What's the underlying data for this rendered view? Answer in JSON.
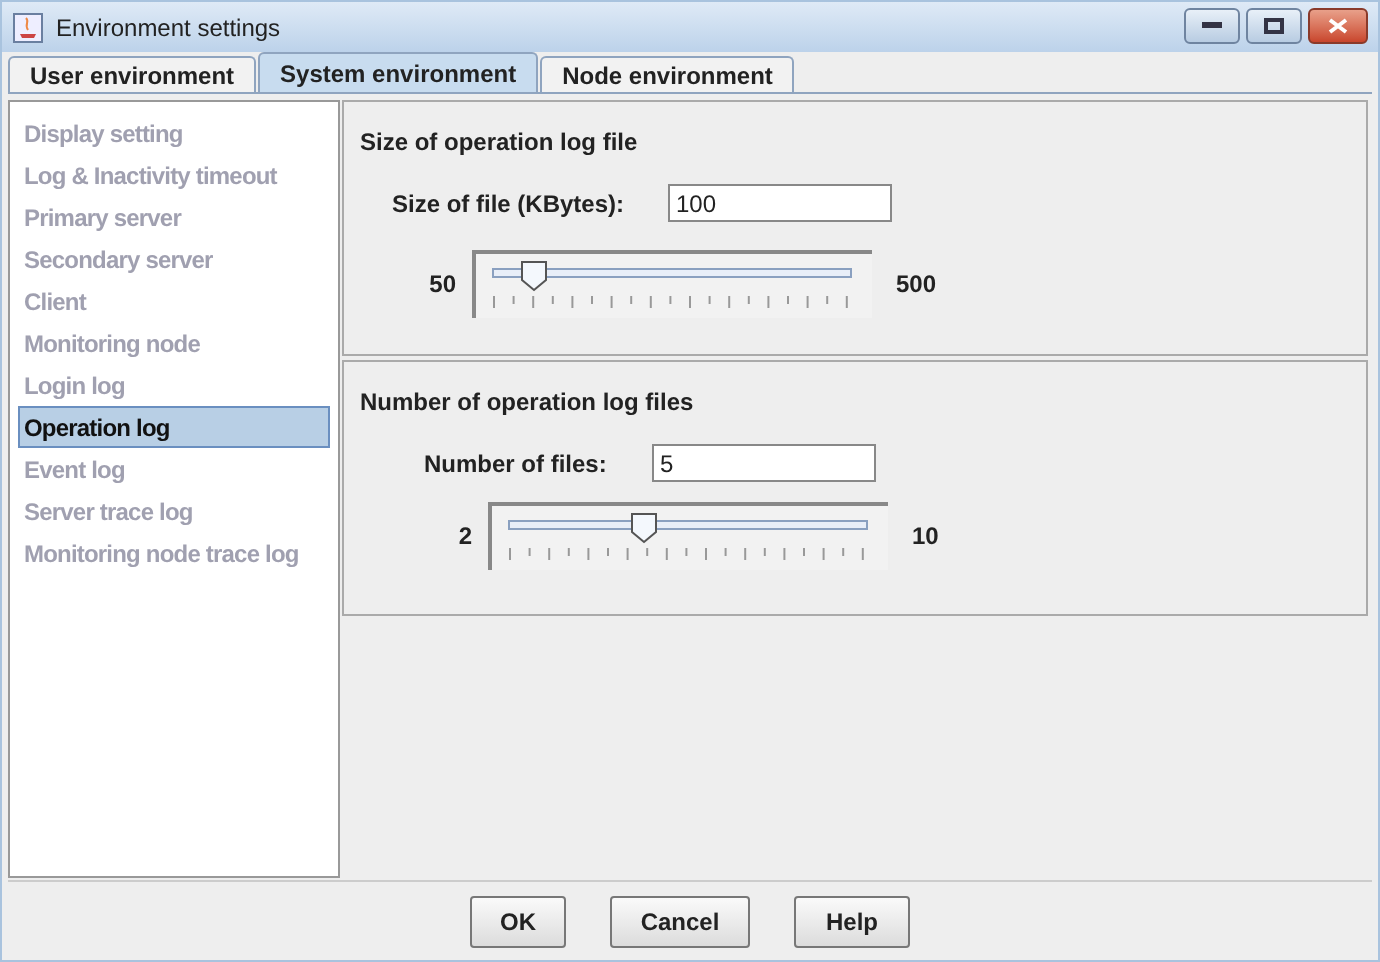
{
  "window": {
    "title": "Environment settings"
  },
  "tabs": [
    {
      "label": "User environment",
      "selected": false
    },
    {
      "label": "System environment",
      "selected": true
    },
    {
      "label": "Node environment",
      "selected": false
    }
  ],
  "sidebar": {
    "items": [
      {
        "label": "Display setting",
        "selected": false
      },
      {
        "label": "Log & Inactivity timeout",
        "selected": false
      },
      {
        "label": "Primary server",
        "selected": false
      },
      {
        "label": "Secondary server",
        "selected": false
      },
      {
        "label": "Client",
        "selected": false
      },
      {
        "label": "Monitoring node",
        "selected": false
      },
      {
        "label": "Login log",
        "selected": false
      },
      {
        "label": "Operation log",
        "selected": true
      },
      {
        "label": "Event log",
        "selected": false
      },
      {
        "label": "Server trace log",
        "selected": false
      },
      {
        "label": "Monitoring node trace log",
        "selected": false
      }
    ]
  },
  "sections": [
    {
      "title": "Size of operation log file",
      "field_label": "Size of file (KBytes):",
      "value": "100",
      "slider": {
        "min_label": "50",
        "max_label": "500",
        "level": 0.11
      }
    },
    {
      "title": "Number of operation log files",
      "field_label": "Number of files:",
      "value": "5",
      "slider": {
        "min_label": "2",
        "max_label": "10",
        "level": 0.375
      }
    }
  ],
  "buttons": [
    "OK",
    "Cancel",
    "Help"
  ]
}
